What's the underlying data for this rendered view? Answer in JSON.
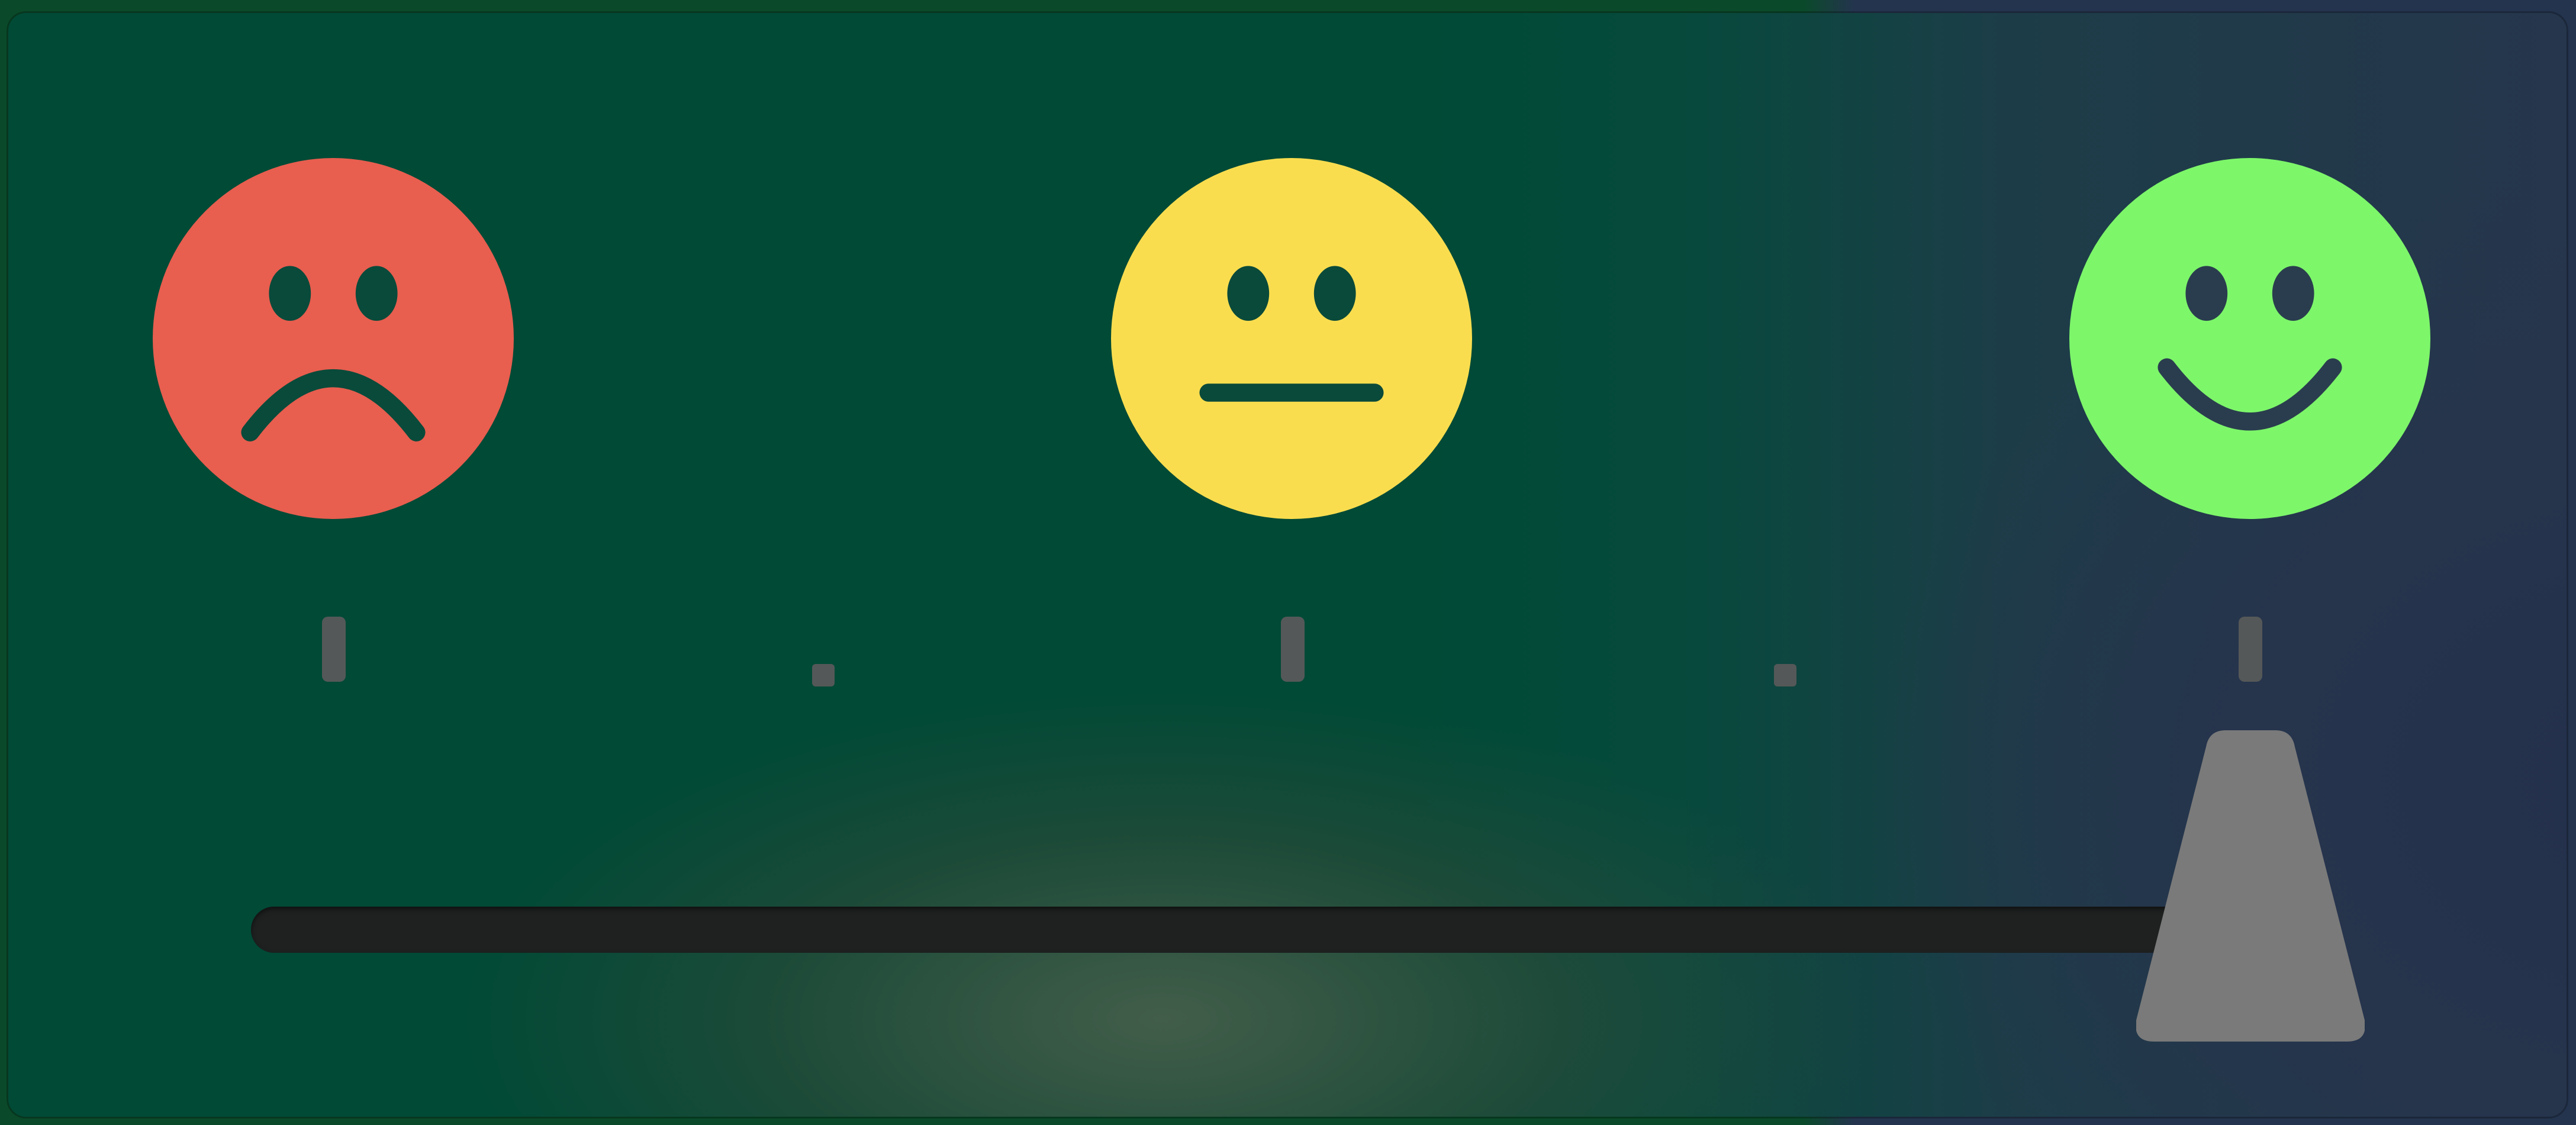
{
  "satisfaction_slider": {
    "options": [
      {
        "name": "sad",
        "color": "#E85E4F"
      },
      {
        "name": "neutral",
        "color": "#FADD4F"
      },
      {
        "name": "happy",
        "color": "#7DF66A"
      }
    ],
    "steps": 5,
    "selected_step": 5,
    "value_fraction": 1.0
  },
  "colors": {
    "face_feature": "#0A4A3A",
    "track": "#1F2121",
    "thumb": "#7A7A7A",
    "tick": "#555858"
  },
  "icons": {
    "sad_face": "frowning-face-icon",
    "neutral_face": "neutral-face-icon",
    "happy_face": "smiling-face-icon"
  }
}
